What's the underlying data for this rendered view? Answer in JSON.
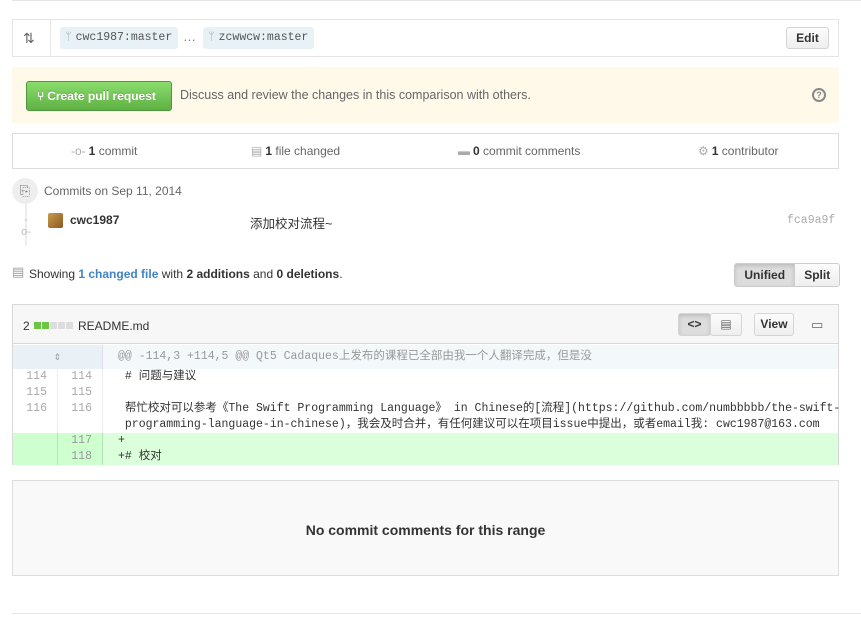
{
  "range": {
    "icon": "git-compare-icon",
    "base": "cwc1987:master",
    "ellipsis": "…",
    "head": "zcwwcw:master",
    "edit_label": "Edit"
  },
  "flash": {
    "button_label": "Create pull request",
    "text": "Discuss and review the changes in this comparison with others.",
    "help_icon": "question-icon"
  },
  "summary": {
    "commits": {
      "count": "1",
      "label": "commit"
    },
    "files": {
      "count": "1",
      "label": "file changed"
    },
    "comments": {
      "count": "0",
      "label": "commit comments"
    },
    "contributors": {
      "count": "1",
      "label": "contributor"
    }
  },
  "commit_group": {
    "title": "Commits on Sep 11, 2014",
    "commits": [
      {
        "author": "cwc1987",
        "message": "添加校对流程~",
        "sha": "fca9a9f"
      }
    ]
  },
  "toc": {
    "prefix": "Showing",
    "changed_link": "1 changed file",
    "with": "with",
    "additions": "2 additions",
    "and": "and",
    "deletions": "0 deletions",
    "suffix": ".",
    "unified_label": "Unified",
    "split_label": "Split"
  },
  "file": {
    "diffstat_count": "2",
    "diffstat_blocks": [
      "added",
      "added",
      "neutral",
      "neutral",
      "neutral"
    ],
    "name": "README.md",
    "view_label": "View",
    "colors": {
      "added": "#6cc644",
      "neutral": "#ddd"
    },
    "diff": [
      {
        "type": "hunk",
        "old": "",
        "new": "",
        "text": "@@ -114,3 +114,5 @@ Qt5 Cadaques上发布的课程已全部由我一个人翻译完成，但是没"
      },
      {
        "type": "context",
        "old": "114",
        "new": "114",
        "text": " # 问题与建议"
      },
      {
        "type": "context",
        "old": "115",
        "new": "115",
        "text": " "
      },
      {
        "type": "context",
        "old": "116",
        "new": "116",
        "text": " 帮忙校对可以参考《The Swift Programming Language》 in Chinese的[流程](https://github.com/numbbbbb/the-swift-\n programming-language-in-chinese)，我会及时合并，有任何建议可以在项目issue中提出，或者email我: cwc1987@163.com"
      },
      {
        "type": "add",
        "old": "",
        "new": "117",
        "text": "+"
      },
      {
        "type": "add",
        "old": "",
        "new": "118",
        "text": "+# 校对"
      }
    ]
  },
  "comments_box": {
    "text": "No commit comments for this range"
  }
}
